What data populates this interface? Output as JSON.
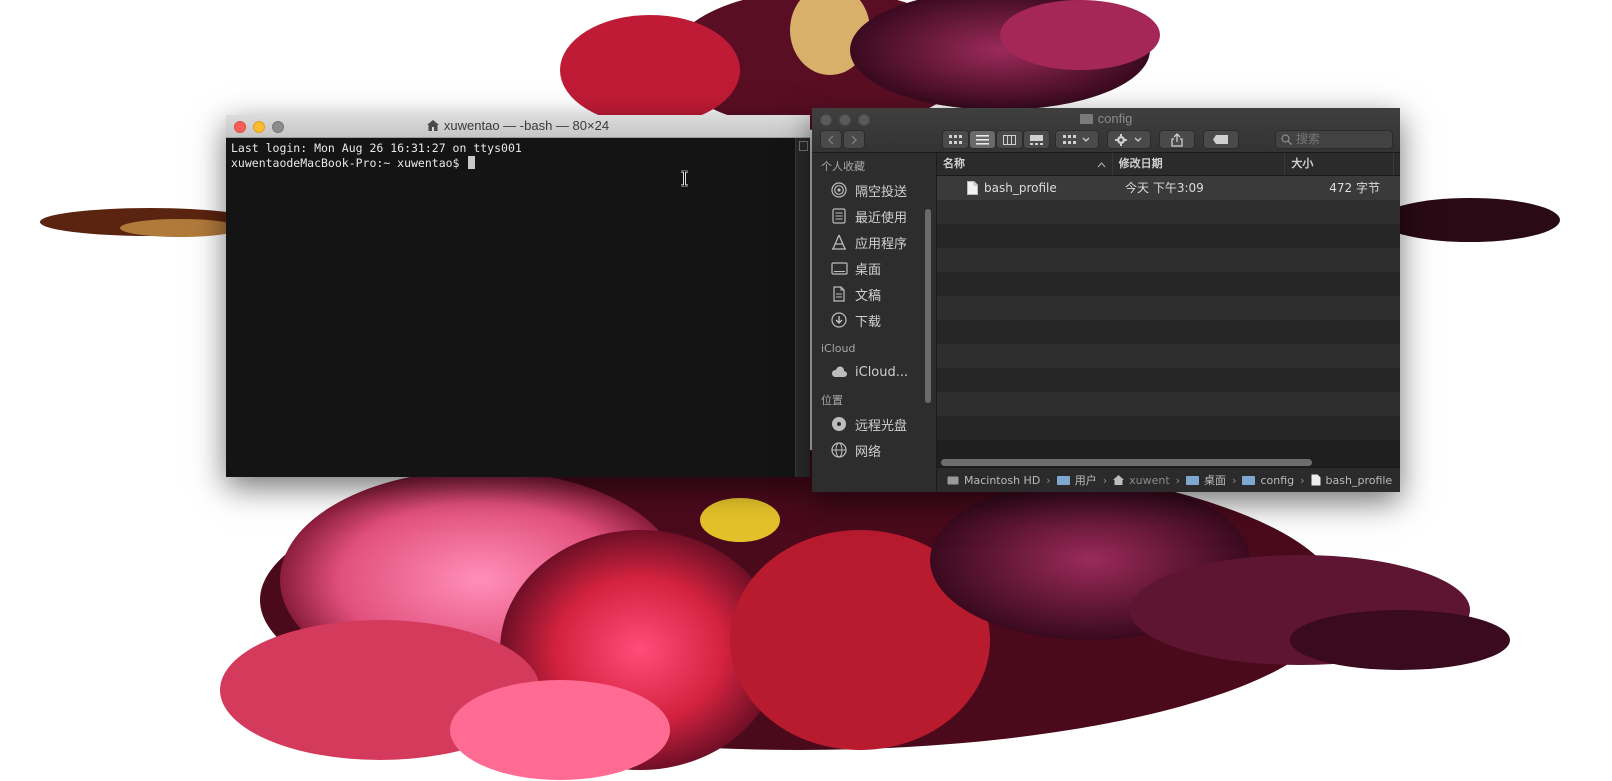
{
  "colors": {
    "traffic_close": "#fc5f57",
    "traffic_minimize": "#fdbc2e",
    "traffic_zoom": "#8c8c8c",
    "terminal_bg": "#141414",
    "finder_bg": "#1f1f1f"
  },
  "terminal": {
    "title": "xuwentao — -bash — 80×24",
    "lines": [
      "Last login: Mon Aug 26 16:31:27 on ttys001",
      "xuwentaodeMacBook-Pro:~ xuwentao$ "
    ]
  },
  "finder": {
    "title": "config",
    "search_placeholder": "搜索",
    "toolbar_icons": [
      "back-icon",
      "forward-icon",
      "icon-view-icon",
      "list-view-icon",
      "column-view-icon",
      "gallery-view-icon",
      "group-icon",
      "action-gear-icon",
      "share-icon",
      "tag-icon"
    ],
    "sidebar": {
      "favorites_header": "个人收藏",
      "favorites": [
        {
          "label": "隔空投送",
          "icon": "airdrop-icon"
        },
        {
          "label": "最近使用",
          "icon": "recents-icon"
        },
        {
          "label": "应用程序",
          "icon": "applications-icon"
        },
        {
          "label": "桌面",
          "icon": "desktop-icon"
        },
        {
          "label": "文稿",
          "icon": "documents-icon"
        },
        {
          "label": "下载",
          "icon": "downloads-icon"
        }
      ],
      "icloud_header": "iCloud",
      "icloud": [
        {
          "label": "iCloud...",
          "icon": "icloud-icon"
        }
      ],
      "locations_header": "位置",
      "locations": [
        {
          "label": "远程光盘",
          "icon": "remote-disc-icon"
        },
        {
          "label": "网络",
          "icon": "network-icon"
        }
      ]
    },
    "columns": {
      "name": "名称",
      "modified": "修改日期",
      "size": "大小"
    },
    "files": [
      {
        "name": "bash_profile",
        "modified": "今天 下午3:09",
        "size": "472 字节"
      }
    ],
    "path": [
      "Macintosh HD",
      "用户",
      "xuwent",
      "桌面",
      "config",
      "bash_profile"
    ]
  }
}
